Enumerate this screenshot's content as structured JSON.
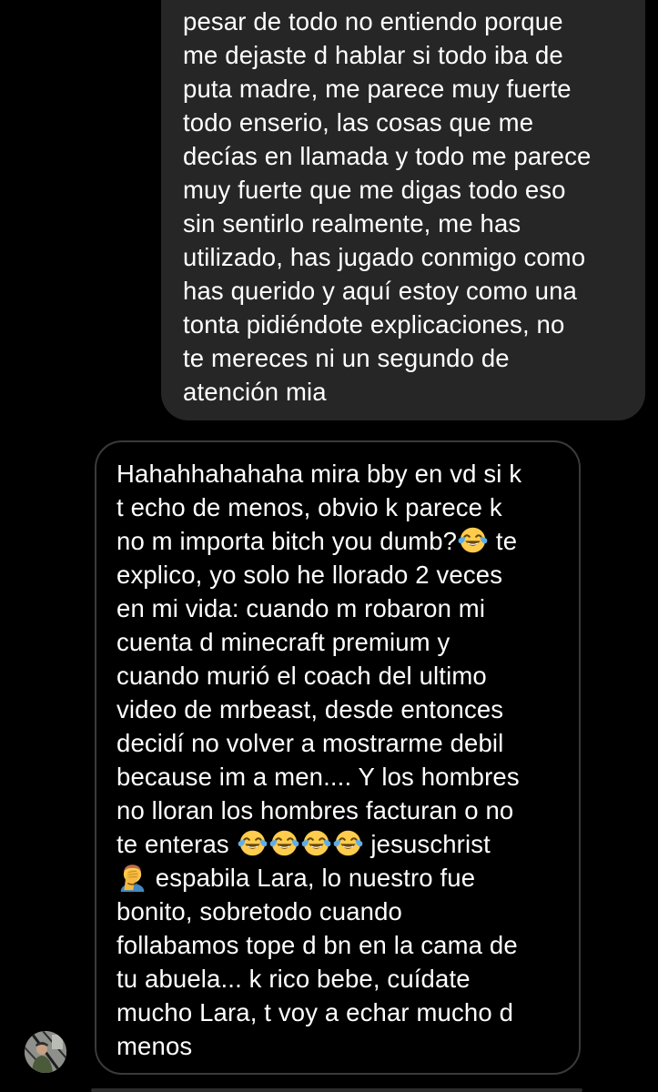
{
  "conversation": {
    "sent_message": {
      "lines": [
        "pesar de todo no entiendo porque",
        "me dejaste d hablar si todo iba de",
        "puta madre, me parece muy fuerte",
        "todo enserio, las cosas que me",
        "decías en llamada y todo me parece",
        "muy fuerte que me digas todo eso",
        "sin sentirlo realmente, me has",
        "utilizado, has jugado conmigo como",
        "has querido y aquí estoy como una",
        "tonta pidiéndote explicaciones, no",
        "te mereces ni un segundo de",
        "atención mia"
      ]
    },
    "received_message": {
      "l01": "Hahahhahahaha mira bby en vd si k",
      "l02": "t echo de menos, obvio k parece k",
      "l03_a": "no m importa bitch you dumb?",
      "l03_b": " te",
      "l04": "explico, yo solo he llorado 2 veces",
      "l05": "en mi vida: cuando m robaron mi",
      "l06": "cuenta d minecraft premium y",
      "l07": "cuando murió el coach del ultimo",
      "l08": "video de mrbeast, desde entonces",
      "l09": "decidí no volver a mostrarme debil",
      "l10": "because im a men.... Y los hombres",
      "l11": "no lloran los hombres facturan o no",
      "l12_a": "te enteras ",
      "l12_b": " jesuschrist",
      "l13_b": " espabila Lara, lo nuestro fue",
      "l14": "bonito, sobretodo cuando",
      "l15": "follabamos tope d bn en la cama de",
      "l16": "tu abuela... k rico bebe, cuídate",
      "l17": "mucho Lara, t voy a echar mucho d",
      "l18": "menos",
      "emoji_names": [
        "face-with-tears-of-joy",
        "man-facepalming"
      ]
    }
  },
  "colors": {
    "background": "#000000",
    "sent_bubble": "#262626",
    "received_border": "#3a3a3a",
    "text": "#ffffff"
  }
}
